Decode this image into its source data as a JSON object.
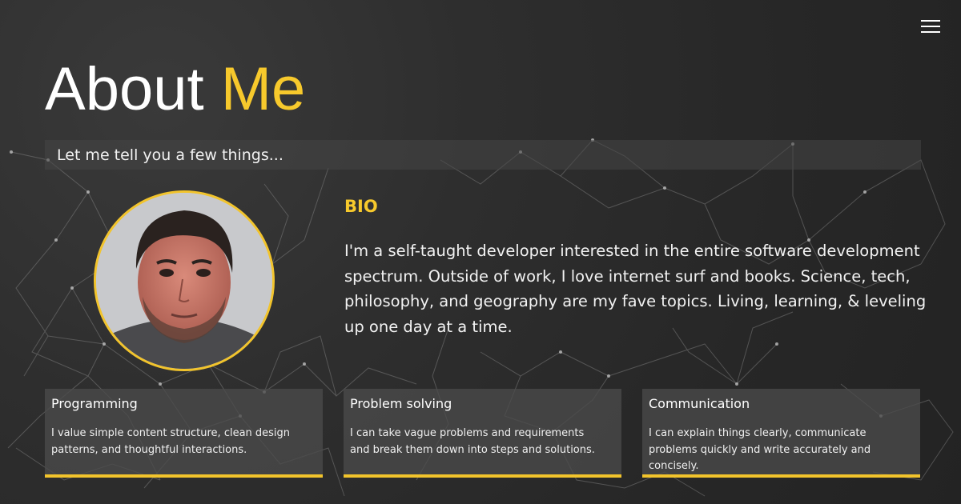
{
  "header": {
    "menu_icon": "hamburger-menu-icon"
  },
  "hero": {
    "title_part1": "About",
    "title_part2": "Me",
    "tagline": "Let me tell you a few things..."
  },
  "bio": {
    "heading": "BIO",
    "text": "I'm a self-taught developer interested in the entire software development spectrum. Outside of work, I love internet surf and books. Science, tech, philosophy, and geography are my fave topics. Living, learning, & leveling up one day at a time."
  },
  "skills": [
    {
      "title": "Programming",
      "description": "I value simple content structure, clean design patterns, and thoughtful interactions."
    },
    {
      "title": "Problem solving",
      "description": "I can take vague problems and requirements and break them down into steps and solutions."
    },
    {
      "title": "Communication",
      "description": "I can explain things clearly, communicate problems quickly and write accurately and concisely."
    }
  ],
  "colors": {
    "accent": "#f7c92c",
    "background": "#2b2b2b",
    "card": "#4a4a4a",
    "text": "#f2f2f2"
  }
}
